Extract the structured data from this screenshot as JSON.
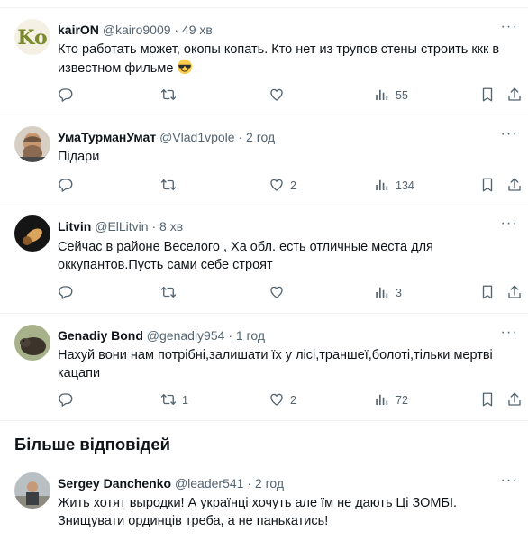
{
  "replies": [
    {
      "name": "kairON",
      "handle": "@kairo9009",
      "dot": "·",
      "time": "49 хв",
      "text": "Кто работать может, окопы копать. Кто нет из трупов стены строить ккк в известном фильме",
      "emoji": "smiling-face-with-sunglasses",
      "counts": {
        "replies": "",
        "reposts": "",
        "likes": "",
        "views": "55"
      }
    },
    {
      "name": "УмаТурманУмат",
      "handle": "@Vlad1vpole",
      "dot": "·",
      "time": "2 год",
      "text": "Підари",
      "counts": {
        "replies": "",
        "reposts": "",
        "likes": "2",
        "views": "134"
      }
    },
    {
      "name": "Litvin",
      "handle": "@ElLitvin",
      "dot": "·",
      "time": "8 хв",
      "text": "Сейчас в районе Веселого , Ха обл. есть отличные места для оккупантов.Пусть сами себе строят",
      "counts": {
        "replies": "",
        "reposts": "",
        "likes": "",
        "views": "3"
      }
    },
    {
      "name": "Genadiy Bond",
      "handle": "@genadiy954",
      "dot": "·",
      "time": "1 год",
      "text": "Нахуй вони нам потрібні,залишати їх у лісі,траншеї,болоті,тільки мертві кацапи",
      "counts": {
        "replies": "",
        "reposts": "1",
        "likes": "2",
        "views": "72"
      }
    }
  ],
  "more_replies": {
    "title": "Більше відповідей",
    "tweet": {
      "name": "Sergey Danchenko",
      "handle": "@leader541",
      "dot": "·",
      "time": "2 год",
      "text": "Жить хотят выродки! А українці хочуть але їм не дають Ці ЗОМБІ. Знищувати ординців треба, а не панькатись!"
    }
  },
  "icons": [
    "reply-icon",
    "repost-icon",
    "like-icon",
    "views-icon",
    "bookmark-icon",
    "share-icon",
    "more-icon"
  ],
  "colors": {
    "text": "#0f1419",
    "secondary": "#536471",
    "divider": "#eff3f4"
  }
}
